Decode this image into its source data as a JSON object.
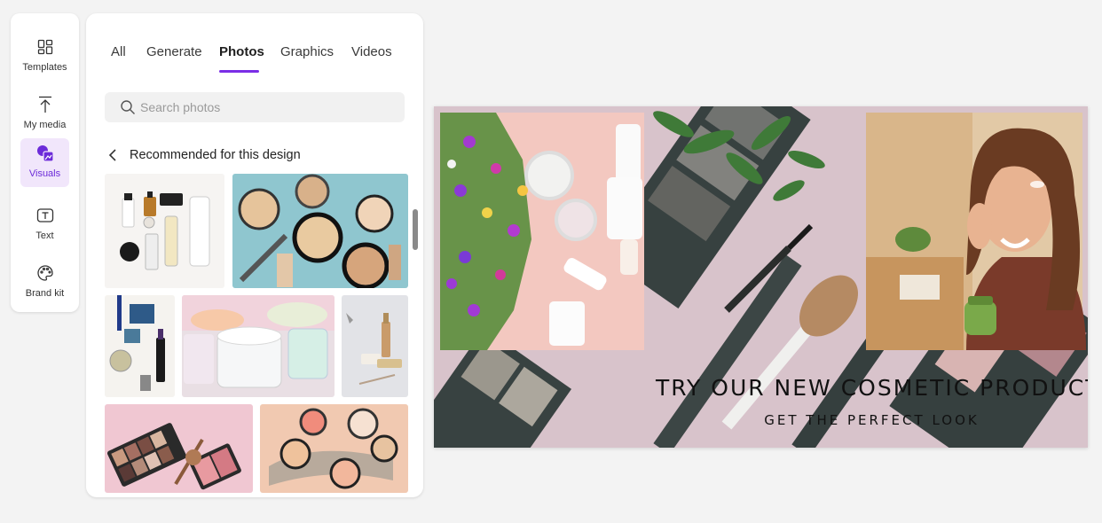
{
  "rail": {
    "items": [
      {
        "label": "Templates",
        "icon": "templates-icon"
      },
      {
        "label": "My media",
        "icon": "upload-icon"
      },
      {
        "label": "Visuals",
        "icon": "visuals-icon",
        "active": true
      },
      {
        "label": "Text",
        "icon": "text-icon"
      },
      {
        "label": "Brand kit",
        "icon": "palette-icon"
      }
    ]
  },
  "panel": {
    "tabs": [
      {
        "label": "All"
      },
      {
        "label": "Generate"
      },
      {
        "label": "Photos",
        "active": true
      },
      {
        "label": "Graphics"
      },
      {
        "label": "Videos"
      }
    ],
    "search": {
      "placeholder": "Search photos",
      "value": ""
    },
    "section_title": "Recommended for this design"
  },
  "canvas": {
    "headline": "TRY OUR NEW COSMETIC PRODUCT",
    "subheadline": "GET THE PERFECT LOOK"
  },
  "colors": {
    "accent": "#7a2ee6",
    "active_bg": "#f1e6fb"
  }
}
